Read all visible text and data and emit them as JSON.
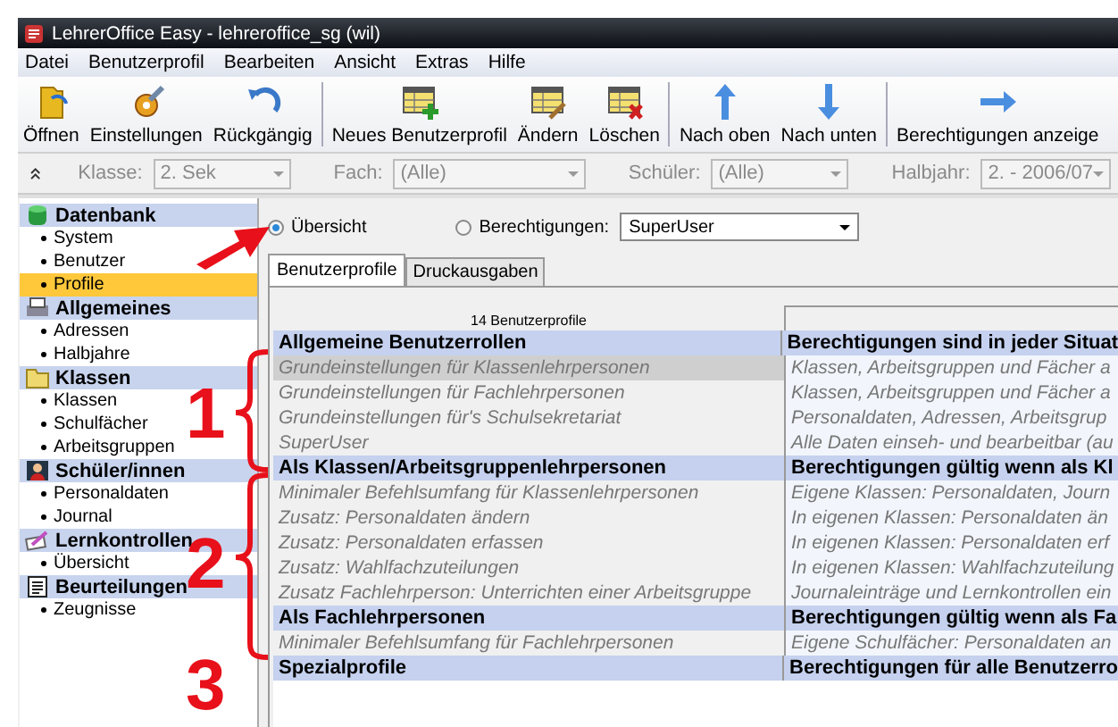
{
  "window": {
    "title": "LehrerOffice Easy - lehreroffice_sg  (wil)"
  },
  "menu": [
    "Datei",
    "Benutzerprofil",
    "Bearbeiten",
    "Ansicht",
    "Extras",
    "Hilfe"
  ],
  "toolbar": [
    {
      "kind": "folder",
      "label": "Öffnen"
    },
    {
      "kind": "settings",
      "label": "Einstellungen"
    },
    {
      "kind": "undo",
      "label": "Rückgängig",
      "separator_after": true
    },
    {
      "kind": "add",
      "label": "Neues Benutzerprofil"
    },
    {
      "kind": "edit",
      "label": "Ändern"
    },
    {
      "kind": "delete",
      "label": "Löschen",
      "separator_after": true
    },
    {
      "kind": "up",
      "label": "Nach oben"
    },
    {
      "kind": "down",
      "label": "Nach unten",
      "separator_after": true
    },
    {
      "kind": "right",
      "label": "Berechtigungen anzeige"
    }
  ],
  "filters": [
    {
      "label": "Klasse:",
      "value": "2. Sek",
      "disabled": true
    },
    {
      "label": "Fach:",
      "value": "(Alle)",
      "disabled": true
    },
    {
      "label": "Schüler:",
      "value": "(Alle)",
      "disabled": true
    },
    {
      "label": "Halbjahr:",
      "value": "2. - 2006/07",
      "disabled": true
    }
  ],
  "sidebar": [
    {
      "kind": "database",
      "title": "Datenbank",
      "items": [
        {
          "label": "System",
          "selected": false
        },
        {
          "label": "Benutzer",
          "selected": false
        },
        {
          "label": "Profile",
          "selected": true
        }
      ]
    },
    {
      "kind": "printer",
      "title": "Allgemeines",
      "items": [
        {
          "label": "Adressen",
          "selected": false
        },
        {
          "label": "Halbjahre",
          "selected": false
        }
      ]
    },
    {
      "kind": "folder",
      "title": "Klassen",
      "items": [
        {
          "label": "Klassen",
          "selected": false
        },
        {
          "label": "Schulfächer",
          "selected": false
        },
        {
          "label": "Arbeitsgruppen",
          "selected": false
        }
      ]
    },
    {
      "kind": "student",
      "title": "Schüler/innen",
      "items": [
        {
          "label": "Personaldaten",
          "selected": false
        },
        {
          "label": "Journal",
          "selected": false
        }
      ]
    },
    {
      "kind": "pen",
      "title": "Lernkontrollen",
      "items": [
        {
          "label": "Übersicht",
          "selected": false
        }
      ]
    },
    {
      "kind": "report",
      "title": "Beurteilungen",
      "items": [
        {
          "label": "Zeugnisse",
          "selected": false
        }
      ]
    }
  ],
  "view_options": [
    {
      "label": "Übersicht",
      "selected": true
    },
    {
      "label": "Berechtigungen:",
      "selected": false,
      "dropdown": "SuperUser"
    }
  ],
  "tabs": [
    {
      "label": "Benutzerprofile",
      "selected": true
    },
    {
      "label": "Druckausgaben",
      "selected": false
    }
  ],
  "table": {
    "count_header": "14 Benutzerprofile",
    "rows": [
      {
        "kind": "group",
        "name": "Allgemeine Benutzerrollen",
        "description": "Berechtigungen sind in jeder Situat"
      },
      {
        "kind": "item",
        "selected": true,
        "name": "Grundeinstellungen für Klassenlehrpersonen",
        "description": "Klassen, Arbeitsgruppen und Fächer a"
      },
      {
        "kind": "item",
        "selected": false,
        "name": "Grundeinstellungen für Fachlehrpersonen",
        "description": "Klassen, Arbeitsgruppen und Fächer a"
      },
      {
        "kind": "item",
        "selected": false,
        "name": "Grundeinstellungen für's Schulsekretariat",
        "description": "Personaldaten, Adressen, Arbeitsgrup"
      },
      {
        "kind": "item",
        "selected": false,
        "name": "SuperUser",
        "description": "Alle Daten einseh- und bearbeitbar (au"
      },
      {
        "kind": "group",
        "name": "Als Klassen/Arbeitsgruppenlehrpersonen",
        "description": "Berechtigungen gültig wenn als Kl"
      },
      {
        "kind": "item",
        "selected": false,
        "name": "Minimaler Befehlsumfang für Klassenlehrpersonen",
        "description": "Eigene Klassen: Personaldaten, Journ"
      },
      {
        "kind": "item",
        "selected": false,
        "name": "Zusatz: Personaldaten ändern",
        "description": "In eigenen Klassen: Personaldaten än"
      },
      {
        "kind": "item",
        "selected": false,
        "name": "Zusatz: Personaldaten erfassen",
        "description": "In eigenen Klassen: Personaldaten erf"
      },
      {
        "kind": "item",
        "selected": false,
        "name": "Zusatz: Wahlfachzuteilungen",
        "description": "In eigenen Klassen: Wahlfachzuteilung"
      },
      {
        "kind": "item",
        "selected": false,
        "name": "Zusatz Fachlehrperson: Unterrichten einer Arbeitsgruppe",
        "description": "Journaleinträge und Lernkontrollen ein"
      },
      {
        "kind": "group",
        "name": "Als Fachlehrpersonen",
        "description": "Berechtigungen gültig wenn als Fa"
      },
      {
        "kind": "item",
        "selected": false,
        "name": "Minimaler Befehlsumfang für Fachlehrpersonen",
        "description": "Eigene Schulfächer: Personaldaten an"
      },
      {
        "kind": "group",
        "name": "Spezialprofile",
        "description": "Berechtigungen für alle Benutzerro"
      }
    ]
  },
  "annotations": [
    {
      "label": "1"
    },
    {
      "label": "2"
    },
    {
      "label": "3"
    }
  ]
}
